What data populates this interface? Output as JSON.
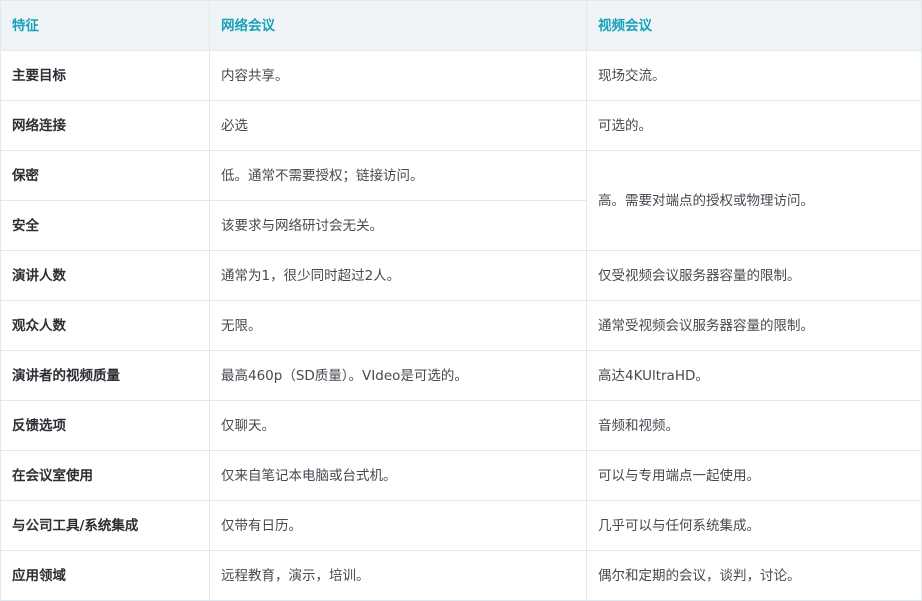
{
  "table": {
    "headers": [
      "特征",
      "网络会议",
      "视频会议"
    ],
    "rows": [
      {
        "feature": "主要目标",
        "web": "内容共享。",
        "video": "现场交流。"
      },
      {
        "feature": "网络连接",
        "web": "必选",
        "video": "可选的。"
      },
      {
        "feature": "保密",
        "web": "低。通常不需要授权；链接访问。",
        "video": "高。需要对端点的授权或物理访问。"
      },
      {
        "feature": "安全",
        "web": "该要求与网络研讨会无关。"
      },
      {
        "feature": "演讲人数",
        "web": "通常为1，很少同时超过2人。",
        "video": "仅受视频会议服务器容量的限制。"
      },
      {
        "feature": "观众人数",
        "web": "无限。",
        "video": "通常受视频会议服务器容量的限制。"
      },
      {
        "feature": "演讲者的视频质量",
        "web": "最高460p（SD质量）。VIdeo是可选的。",
        "video": "高达4KUltraHD。"
      },
      {
        "feature": "反馈选项",
        "web": "仅聊天。",
        "video": "音频和视频。"
      },
      {
        "feature": "在会议室使用",
        "web": "仅来自笔记本电脑或台式机。",
        "video": "可以与专用端点一起使用。"
      },
      {
        "feature": "与公司工具/系统集成",
        "web": "仅带有日历。",
        "video": "几乎可以与任何系统集成。"
      },
      {
        "feature": "应用领域",
        "web": "远程教育，演示，培训。",
        "video": "偶尔和定期的会议，谈判，讨论。"
      }
    ]
  }
}
